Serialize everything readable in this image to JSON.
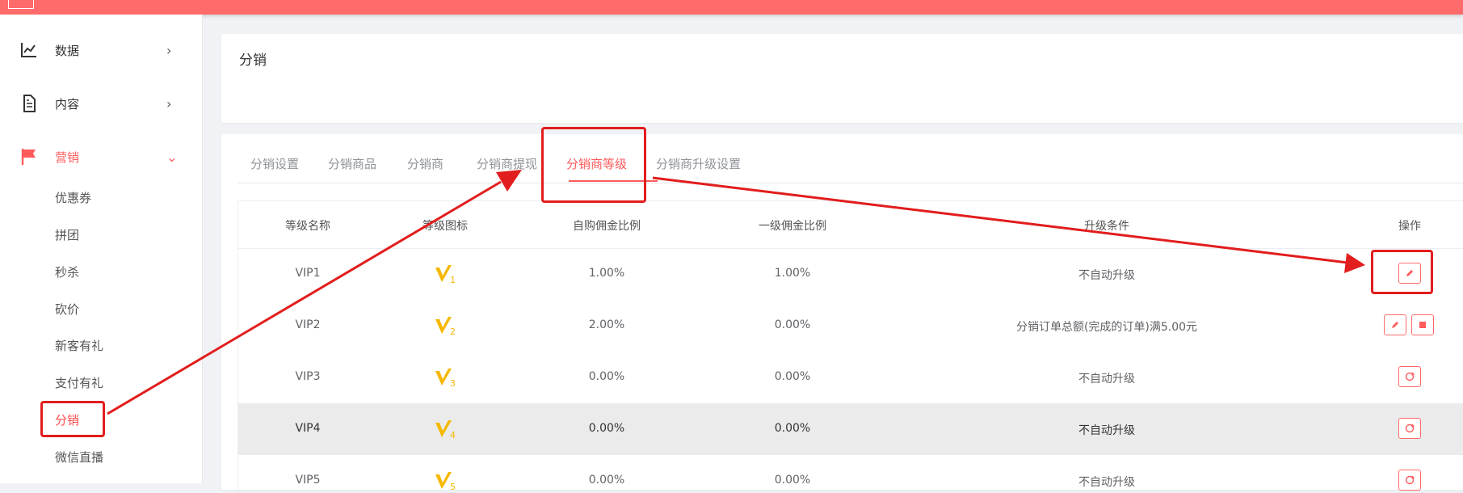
{
  "colors": {
    "brand": "#ff6b6b",
    "accent": "#ff5b5b",
    "annotation": "#e21d1d",
    "vip_icon": "#f5b800"
  },
  "sidebar": {
    "menu": [
      {
        "label": "数据",
        "icon": "line-chart-icon",
        "arrow": "›"
      },
      {
        "label": "内容",
        "icon": "document-icon",
        "arrow": "›"
      },
      {
        "label": "营销",
        "icon": "flag-icon",
        "arrow": "⌄"
      }
    ],
    "submenu": [
      "优惠券",
      "拼团",
      "秒杀",
      "砍价",
      "新客有礼",
      "支付有礼",
      "分销",
      "微信直播"
    ]
  },
  "page": {
    "title": "分销"
  },
  "tabs": [
    "分销设置",
    "分销商品",
    "分销商",
    "分销商提现",
    "分销商等级",
    "分销商升级设置"
  ],
  "table": {
    "headers": [
      "等级名称",
      "等级图标",
      "自购佣金比例",
      "一级佣金比例",
      "升级条件",
      "操作"
    ],
    "rows": [
      {
        "name": "VIP1",
        "icon_level": "1",
        "self_ratio": "1.00%",
        "level1_ratio": "1.00%",
        "condition": "不自动升级",
        "actions": [
          "edit"
        ]
      },
      {
        "name": "VIP2",
        "icon_level": "2",
        "self_ratio": "2.00%",
        "level1_ratio": "0.00%",
        "condition": "分销订单总额(完成的订单)满5.00元",
        "actions": [
          "edit",
          "stop"
        ]
      },
      {
        "name": "VIP3",
        "icon_level": "3",
        "self_ratio": "0.00%",
        "level1_ratio": "0.00%",
        "condition": "不自动升级",
        "actions": [
          "refresh"
        ]
      },
      {
        "name": "VIP4",
        "icon_level": "4",
        "self_ratio": "0.00%",
        "level1_ratio": "0.00%",
        "condition": "不自动升级",
        "actions": [
          "refresh"
        ]
      },
      {
        "name": "VIP5",
        "icon_level": "5",
        "self_ratio": "0.00%",
        "level1_ratio": "0.00%",
        "condition": "不自动升级",
        "actions": [
          "refresh"
        ]
      }
    ]
  }
}
